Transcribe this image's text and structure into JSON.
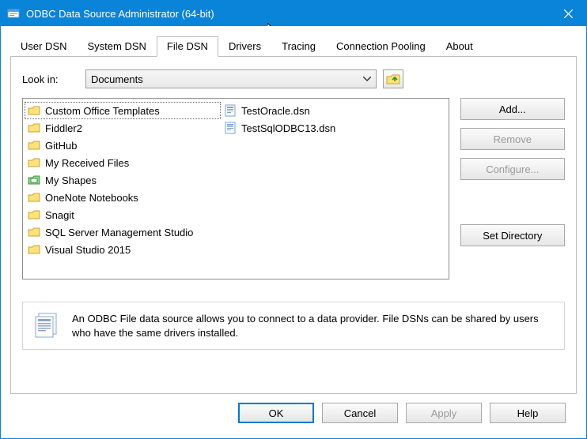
{
  "window": {
    "title": "ODBC Data Source Administrator (64-bit)"
  },
  "tabs": {
    "items": [
      {
        "label": "User DSN"
      },
      {
        "label": "System DSN"
      },
      {
        "label": "File DSN"
      },
      {
        "label": "Drivers"
      },
      {
        "label": "Tracing"
      },
      {
        "label": "Connection Pooling"
      },
      {
        "label": "About"
      }
    ],
    "active_index": 2
  },
  "lookin": {
    "label": "Look in:",
    "value": "Documents"
  },
  "filelist": {
    "col1": [
      {
        "name": "Custom Office Templates",
        "icon": "folder",
        "selected": true
      },
      {
        "name": "Fiddler2",
        "icon": "folder"
      },
      {
        "name": "GitHub",
        "icon": "folder"
      },
      {
        "name": "My Received Files",
        "icon": "folder"
      },
      {
        "name": "My Shapes",
        "icon": "folder-green"
      },
      {
        "name": "OneNote Notebooks",
        "icon": "folder"
      },
      {
        "name": "Snagit",
        "icon": "folder"
      },
      {
        "name": "SQL Server Management Studio",
        "icon": "folder"
      },
      {
        "name": "Visual Studio 2015",
        "icon": "folder"
      }
    ],
    "col2": [
      {
        "name": "TestOracle.dsn",
        "icon": "dsn"
      },
      {
        "name": "TestSqlODBC13.dsn",
        "icon": "dsn"
      }
    ]
  },
  "sidebuttons": {
    "add": "Add...",
    "remove": "Remove",
    "configure": "Configure...",
    "set_directory": "Set Directory"
  },
  "description": "An ODBC File data source allows you to connect to a data provider.  File DSNs can be shared by users who have the same drivers installed.",
  "bottom": {
    "ok": "OK",
    "cancel": "Cancel",
    "apply": "Apply",
    "help": "Help"
  }
}
